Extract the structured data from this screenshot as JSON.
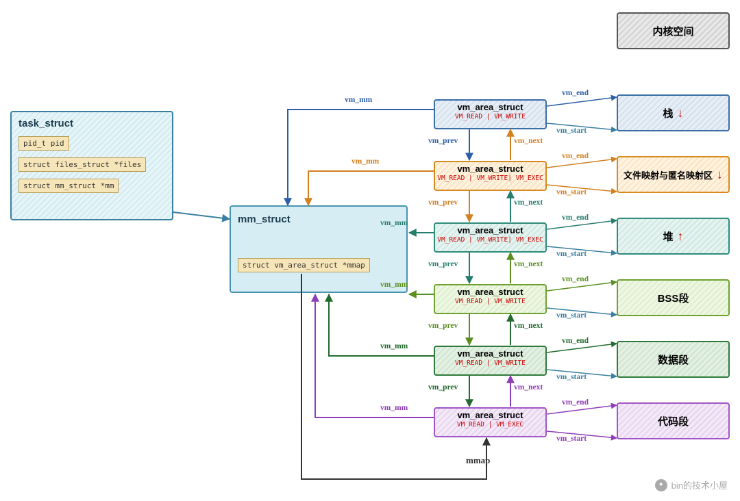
{
  "task_struct": {
    "title": "task_struct",
    "fields": [
      "pid_t  pid",
      "struct files_struct *files",
      "struct mm_struct   *mm"
    ]
  },
  "mm_struct": {
    "title": "mm_struct",
    "field": "struct vm_area_struct *mmap"
  },
  "vmas": [
    {
      "title": "vm_area_struct",
      "perms": "VM_READ | VM_WRITE"
    },
    {
      "title": "vm_area_struct",
      "perms": "VM_READ | VM_WRITE| VM_EXEC"
    },
    {
      "title": "vm_area_struct",
      "perms": "VM_READ | VM_WRITE| VM_EXEC"
    },
    {
      "title": "vm_area_struct",
      "perms": "VM_READ | VM_WRITE"
    },
    {
      "title": "vm_area_struct",
      "perms": "VM_READ | VM_WRITE"
    },
    {
      "title": "vm_area_struct",
      "perms": "VM_READ | VM_EXEC"
    }
  ],
  "regions": {
    "kernel": "内核空间",
    "stack": "栈",
    "mmap": "文件映射与匿名映射区",
    "heap": "堆",
    "bss": "BSS段",
    "data": "数据段",
    "text": "代码段"
  },
  "arrows": {
    "down": "↓",
    "up": "↑"
  },
  "labels": {
    "vm_mm": "vm_mm",
    "vm_prev": "vm_prev",
    "vm_next": "vm_next",
    "vm_end": "vm_end",
    "vm_start": "vm_start",
    "mmap": "mmap"
  },
  "watermark": "bin的技术小屋"
}
